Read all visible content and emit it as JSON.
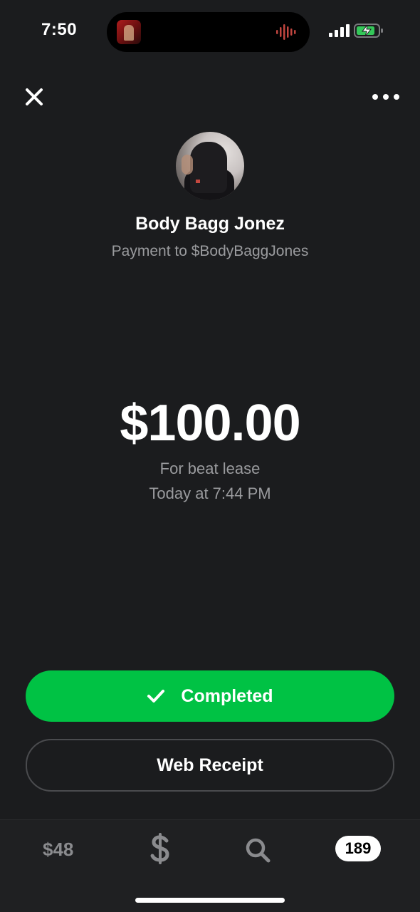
{
  "status_bar": {
    "time": "7:50",
    "icons": [
      "now-playing-art-icon",
      "audio-wave-icon",
      "cellular-signal-icon",
      "battery-charging-icon"
    ]
  },
  "header": {
    "close_icon": "close-icon",
    "more_icon": "more-options-icon"
  },
  "profile": {
    "name": "Body Bagg Jonez",
    "subtitle": "Payment to $BodyBaggJones"
  },
  "payment": {
    "amount": "$100.00",
    "note": "For beat lease",
    "timestamp": "Today at 7:44 PM"
  },
  "actions": {
    "status_label": "Completed",
    "status_icon": "checkmark-icon",
    "receipt_label": "Web Receipt"
  },
  "tab_bar": {
    "balance": "$48",
    "pay_icon": "dollar-icon",
    "search_icon": "search-icon",
    "activity_count": "189"
  },
  "colors": {
    "background": "#1b1c1e",
    "accent_green": "#00c244",
    "secondary_text": "#9a9b9e"
  }
}
